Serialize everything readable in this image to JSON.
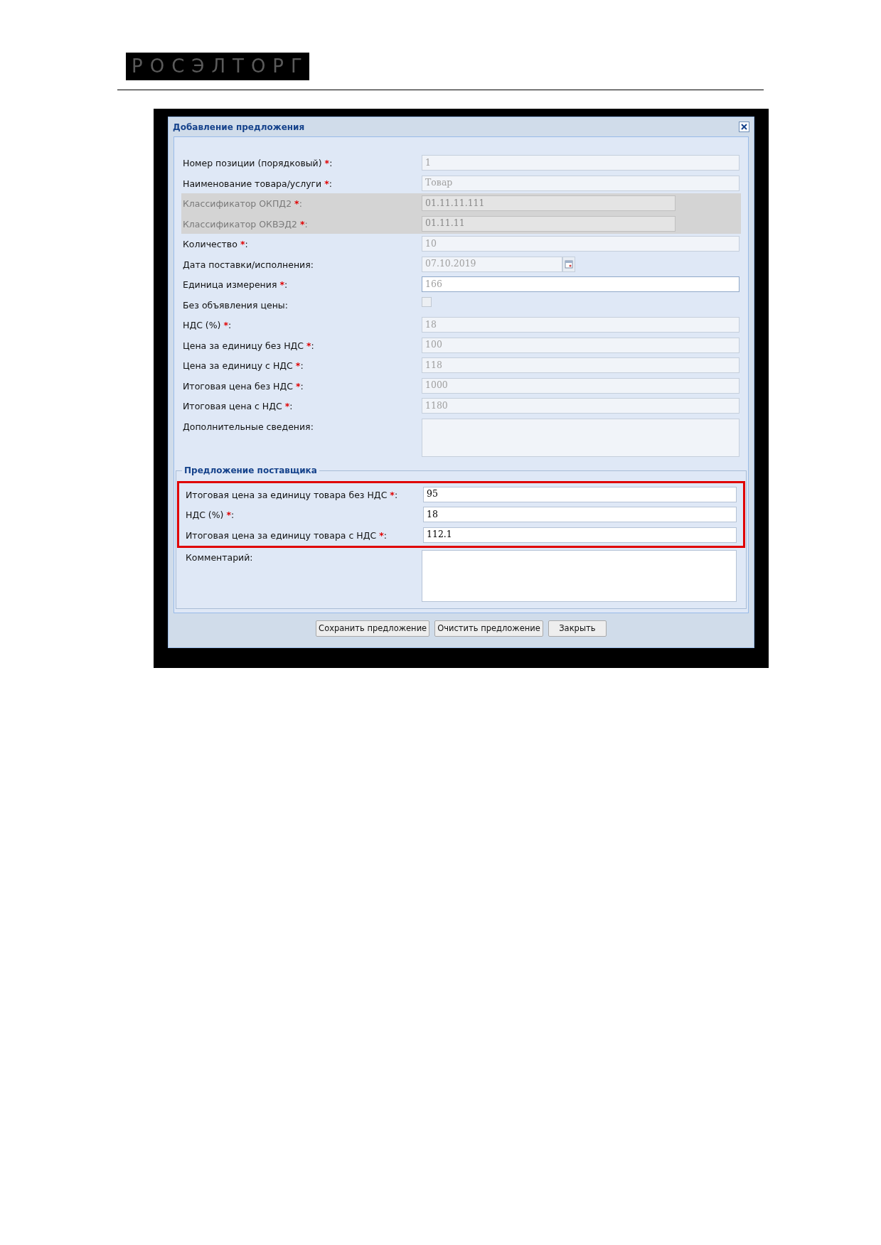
{
  "logo": {
    "text": "РОСЭЛТОРГ"
  },
  "dialog": {
    "title": "Добавление предложения",
    "fields": [
      {
        "label": "Номер позиции (порядковый)",
        "required_mark": "*",
        "colon": ":",
        "kind": "text",
        "value": "1",
        "disabled": false
      },
      {
        "label": "Наименование товара/услуги",
        "required_mark": "*",
        "colon": ":",
        "kind": "text",
        "value": "Товар",
        "disabled": false
      },
      {
        "label": "Классификатор ОКПД2",
        "required_mark": "*",
        "colon": ":",
        "kind": "short",
        "value": "01.11.11.111",
        "disabled": true
      },
      {
        "label": "Классификатор ОКВЭД2",
        "required_mark": "*",
        "colon": ":",
        "kind": "short",
        "value": "01.11.11",
        "disabled": true
      },
      {
        "label": "Количество",
        "required_mark": "*",
        "colon": ":",
        "kind": "text",
        "value": "10",
        "disabled": false
      },
      {
        "label": "Дата поставки/исполнения:",
        "kind": "date",
        "value": "07.10.2019",
        "disabled": false
      },
      {
        "label": "Единица измерения",
        "required_mark": "*",
        "colon": ":",
        "kind": "focused",
        "value": "166",
        "disabled": false
      },
      {
        "label": "Без объявления цены:",
        "kind": "checkbox",
        "checked": false,
        "disabled": false
      },
      {
        "label": "НДС (%)",
        "required_mark": "*",
        "colon": ":",
        "kind": "text",
        "value": "18",
        "disabled": false
      },
      {
        "label": "Цена за единицу без НДС",
        "required_mark": "*",
        "colon": ":",
        "kind": "text",
        "value": "100",
        "disabled": false
      },
      {
        "label": "Цена за единицу с НДС",
        "required_mark": "*",
        "colon": ":",
        "kind": "text",
        "value": "118",
        "disabled": false
      },
      {
        "label": "Итоговая цена без НДС",
        "required_mark": "*",
        "colon": ":",
        "kind": "text",
        "value": "1000",
        "disabled": false
      },
      {
        "label": "Итоговая цена с НДС",
        "required_mark": "*",
        "colon": ":",
        "kind": "text",
        "value": "1180",
        "disabled": false
      },
      {
        "label": "Дополнительные сведения:",
        "kind": "textarea",
        "disabled": false
      }
    ],
    "supplier": {
      "legend": "Предложение поставщика",
      "highlighted_fields": [
        {
          "label": "Итоговая цена за единицу товара без НДС",
          "required_mark": "*",
          "colon": ":",
          "value": "95"
        },
        {
          "label": "НДС (%)",
          "required_mark": "*",
          "colon": ":",
          "value": "18"
        },
        {
          "label": "Итоговая цена за единицу товара с НДС",
          "required_mark": "*",
          "colon": ":",
          "value": "112.1"
        }
      ],
      "comment": {
        "label": "Комментарий:"
      }
    },
    "buttons": [
      "Сохранить предложение",
      "Очистить предложение",
      "Закрыть"
    ]
  }
}
